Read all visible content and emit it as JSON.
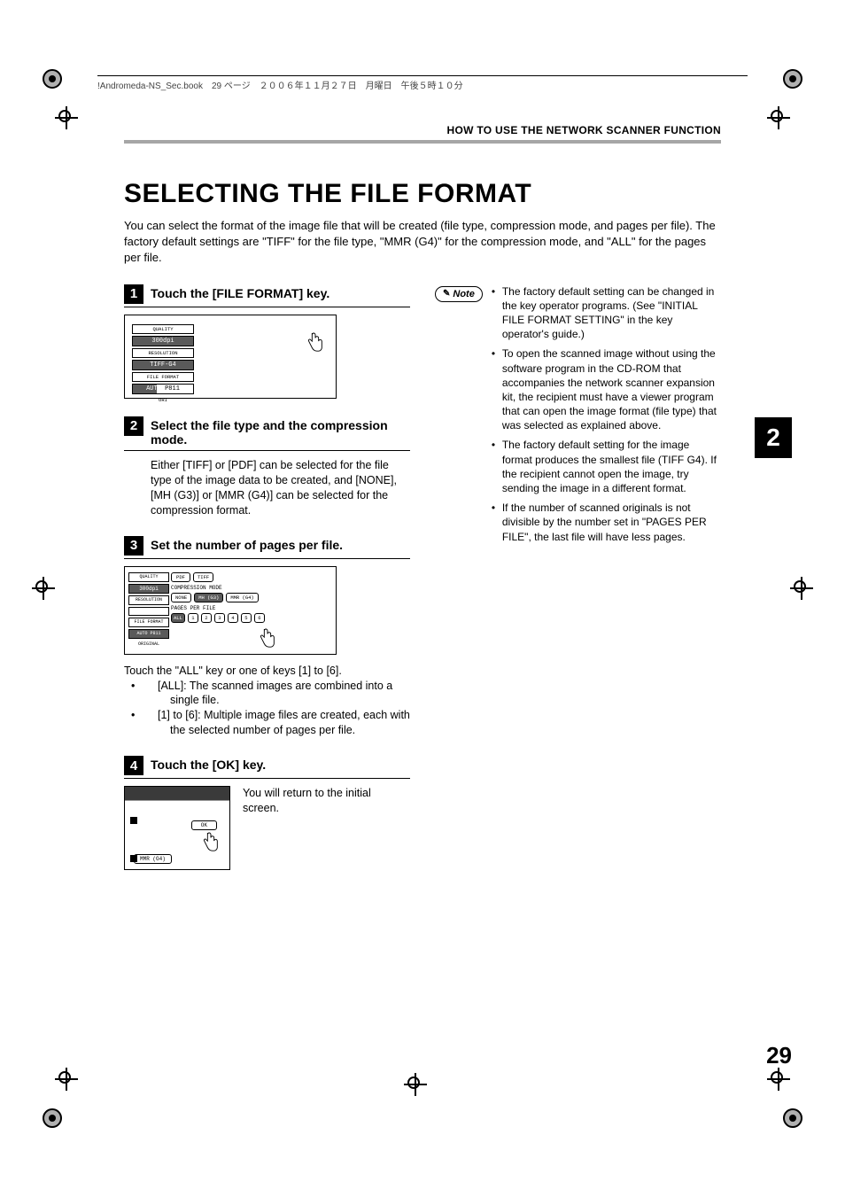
{
  "crop": {
    "book_header": "!Andromeda-NS_Sec.book　29 ページ　２００６年１１月２７日　月曜日　午後５時１０分"
  },
  "running_head": "HOW TO USE THE NETWORK SCANNER FUNCTION",
  "title": "SELECTING THE FILE FORMAT",
  "intro": "You can select the format of the image file that will be created (file type, compression mode, and pages per file). The factory default settings are \"TIFF\" for the file type, \"MMR (G4)\" for the compression mode, and \"ALL\" for the pages per file.",
  "thumb_tab": "2",
  "page_number": "29",
  "steps": {
    "s1": {
      "num": "1",
      "title": "Touch the [FILE FORMAT] key.",
      "panel": {
        "quality_label": "QUALITY",
        "res_value": "300dpi",
        "res_label": "RESOLUTION",
        "ff_value": "TIFF-G4",
        "ff_label": "FILE FORMAT",
        "auto": "AUTO",
        "p811": "P811",
        "ori": "ORI"
      }
    },
    "s2": {
      "num": "2",
      "title": "Select the file type and the compression mode.",
      "body": "Either [TIFF] or [PDF] can be selected for the file type of the image data to be created, and [NONE], [MH (G3)] or [MMR (G4)] can be selected for the compression format."
    },
    "s3": {
      "num": "3",
      "title": "Set the number of pages per file.",
      "panel": {
        "quality": "QUALITY",
        "res_value": "300dpi",
        "res_label": "RESOLUTION",
        "ff_label": "FILE FORMAT",
        "auto_p811": "AUTO   P811",
        "original": "ORIGINAL",
        "row1_btns": [
          "PDF",
          "TIFF"
        ],
        "row2_label": "COMPRESSION MODE",
        "row2_btns": [
          "NONE",
          "MH (G3)",
          "MMR (G4)"
        ],
        "row3_label": "PAGES PER FILE",
        "row3_btns": [
          "ALL",
          "1",
          "2",
          "3",
          "4",
          "5",
          "6"
        ]
      },
      "after_intro": "Touch the \"ALL\" key or one of keys [1] to [6].",
      "after_items": [
        {
          "tag": "[ALL]:",
          "text": "The scanned images are combined into a single file."
        },
        {
          "tag": "[1] to [6]:",
          "text": "Multiple image files are created, each with the selected number of pages per file."
        }
      ]
    },
    "s4": {
      "num": "4",
      "title": "Touch the [OK] key.",
      "panel": {
        "ok": "OK",
        "mmr": "MMR (G4)"
      },
      "body": "You will return to the initial screen."
    }
  },
  "note": {
    "label": "Note",
    "items": [
      "The factory default setting can be changed in the key operator programs. (See \"INITIAL FILE FORMAT SETTING\" in the key operator's guide.)",
      "To open the scanned image without using the software program in the CD-ROM that accompanies the network scanner expansion kit, the recipient must have a viewer program that can open the image format (file type) that was selected as explained above.",
      "The factory default setting for the image format produces the smallest file (TIFF G4). If the recipient cannot open the image, try sending the image in a different format.",
      "If the number of scanned originals is not divisible by the number set in \"PAGES PER FILE\", the last file will have less pages."
    ]
  }
}
